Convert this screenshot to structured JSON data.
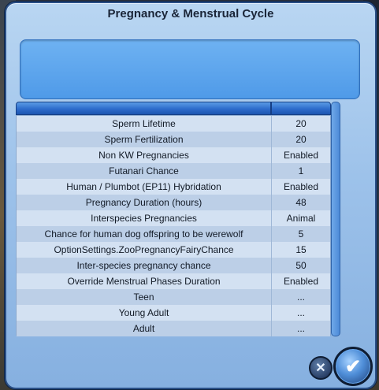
{
  "dialog": {
    "title": "Pregnancy & Menstrual Cycle"
  },
  "settings": [
    {
      "label": "Sperm Lifetime",
      "value": "20"
    },
    {
      "label": "Sperm Fertilization",
      "value": "20"
    },
    {
      "label": "Non KW Pregnancies",
      "value": "Enabled"
    },
    {
      "label": "Futanari Chance",
      "value": "1"
    },
    {
      "label": "Human / Plumbot (EP11) Hybridation",
      "value": "Enabled"
    },
    {
      "label": "Pregnancy Duration (hours)",
      "value": "48"
    },
    {
      "label": "Interspecies Pregnancies",
      "value": "Animal"
    },
    {
      "label": "Chance for human dog offspring to be werewolf",
      "value": "5"
    },
    {
      "label": "OptionSettings.ZooPregnancyFairyChance",
      "value": "15"
    },
    {
      "label": "Inter-species pregnancy chance",
      "value": "50"
    },
    {
      "label": "Override Menstrual Phases Duration",
      "value": "Enabled"
    },
    {
      "label": "Teen",
      "value": "..."
    },
    {
      "label": "Young Adult",
      "value": "..."
    },
    {
      "label": "Adult",
      "value": "..."
    }
  ],
  "buttons": {
    "close_icon": "close-icon",
    "ok_icon": "checkmark-icon",
    "close_glyph": "✕",
    "ok_glyph": "✔"
  },
  "colors": {
    "dialog_blue": "#9dc2ea",
    "header_blue": "#2d6ccc",
    "info_blue": "#4f9ae8"
  }
}
